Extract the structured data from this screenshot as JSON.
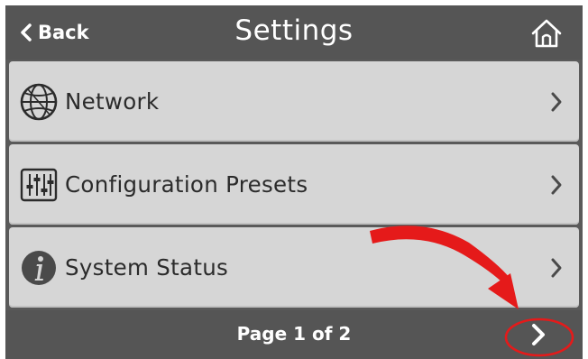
{
  "header": {
    "back_label": "Back",
    "title": "Settings",
    "back_icon": "chevron-left-icon",
    "home_icon": "home-icon"
  },
  "menu": {
    "items": [
      {
        "label": "Network",
        "icon": "globe-icon"
      },
      {
        "label": "Configuration Presets",
        "icon": "sliders-icon"
      },
      {
        "label": "System Status",
        "icon": "info-icon"
      }
    ]
  },
  "footer": {
    "page_label": "Page 1 of 2",
    "next_icon": "chevron-right-icon"
  },
  "colors": {
    "bar": "#555555",
    "row": "#d6d6d6",
    "text": "#2b2b2b",
    "annotation": "#e51a1a"
  }
}
